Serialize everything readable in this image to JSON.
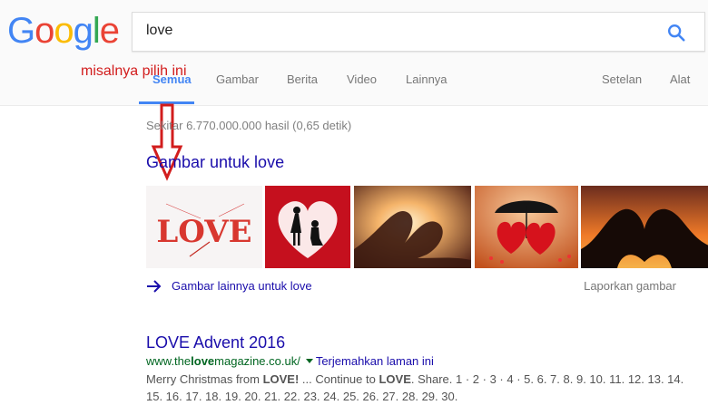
{
  "logo": {
    "letters": [
      "G",
      "o",
      "o",
      "g",
      "l",
      "e"
    ],
    "colors": [
      "#4285f4",
      "#ea4335",
      "#fbbc05",
      "#4285f4",
      "#34a853",
      "#ea4335"
    ]
  },
  "search": {
    "query": "love",
    "icon": "search-icon"
  },
  "tabs": {
    "all": "Semua",
    "images": "Gambar",
    "news": "Berita",
    "video": "Video",
    "more": "Lainnya",
    "settings": "Setelan",
    "tools": "Alat"
  },
  "annotation": "misalnya pilih ini",
  "stats": "Sekitar 6.770.000.000 hasil (0,65 detik)",
  "images_section": {
    "heading": "Gambar untuk love",
    "more_link": "Gambar lainnya untuk love",
    "report_link": "Laporkan gambar",
    "thumb1_text": "LOVE"
  },
  "result": {
    "title": "LOVE Advent 2016",
    "url_pre": "www.the",
    "url_bold": "love",
    "url_post": "magazine.co.uk/",
    "translate": "Terjemahkan laman ini",
    "snippet_1": "Merry Christmas from ",
    "snippet_2": "LOVE!",
    "snippet_3": " ... Continue to ",
    "snippet_4": "LOVE",
    "snippet_5": ". Share. 1 · 2 · 3 · 4 · 5. 6. 7. 8. 9. 10. 11. 12. 13. 14. 15. 16. 17. 18. 19. 20. 21. 22. 23. 24. 25. 26. 27. 28. 29. 30."
  },
  "colors": {
    "link": "#1a0dab",
    "url": "#006621",
    "annotation": "#d21d1d",
    "accent": "#4285f4"
  }
}
